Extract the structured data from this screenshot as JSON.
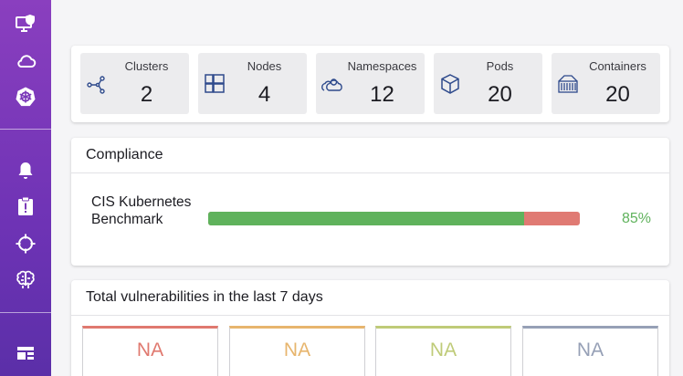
{
  "sidebar": {
    "top_icons": [
      "monitor-shield-icon",
      "cloud-icon",
      "kubernetes-icon"
    ],
    "mid_icons": [
      "bell-icon",
      "clipboard-alert-icon",
      "crosshair-icon",
      "brain-icon"
    ],
    "bottom_icons": [
      "dashboard-icon"
    ]
  },
  "summary": {
    "tiles": [
      {
        "label": "Clusters",
        "value": "2",
        "icon": "graph-nodes-icon"
      },
      {
        "label": "Nodes",
        "value": "4",
        "icon": "grid-icon"
      },
      {
        "label": "Namespaces",
        "value": "12",
        "icon": "cloud-group-icon"
      },
      {
        "label": "Pods",
        "value": "20",
        "icon": "cube-icon"
      },
      {
        "label": "Containers",
        "value": "20",
        "icon": "container-icon"
      }
    ]
  },
  "compliance": {
    "title": "Compliance",
    "benchmark_label": "CIS Kubernetes Benchmark",
    "percent_text": "85%",
    "percent_value": 0.85,
    "pass_color": "#5fb25c",
    "fail_color": "#e07a73"
  },
  "vulnerabilities": {
    "title": "Total vulnerabilities in the last 7 days",
    "boxes": [
      {
        "value": "NA",
        "color": "#e0796f"
      },
      {
        "value": "NA",
        "color": "#e7b56d"
      },
      {
        "value": "NA",
        "color": "#bfcb78"
      },
      {
        "value": "NA",
        "color": "#96a0b6"
      }
    ]
  }
}
